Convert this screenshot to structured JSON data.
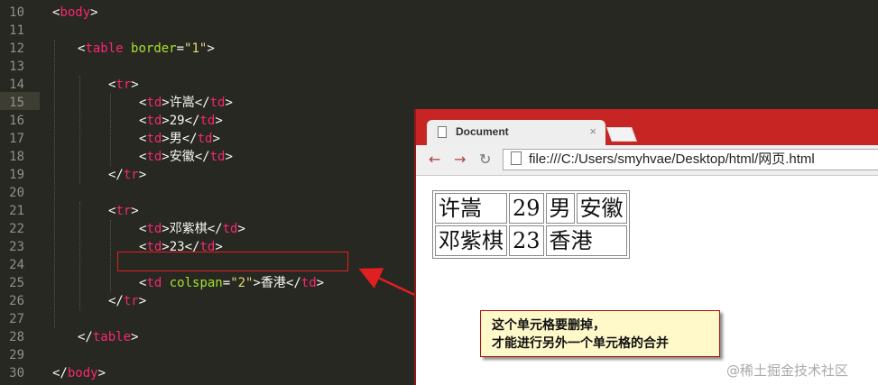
{
  "editor": {
    "lines": [
      {
        "n": "10",
        "tokens": [
          {
            "t": "<",
            "c": "plain"
          },
          {
            "t": "body",
            "c": "tag"
          },
          {
            "t": ">",
            "c": "plain"
          }
        ],
        "indent": 0
      },
      {
        "n": "11",
        "tokens": [],
        "indent": 0
      },
      {
        "n": "12",
        "tokens": [
          {
            "t": "<",
            "c": "plain"
          },
          {
            "t": "table",
            "c": "tag"
          },
          {
            "t": " ",
            "c": "plain"
          },
          {
            "t": "border",
            "c": "attr"
          },
          {
            "t": "=",
            "c": "plain"
          },
          {
            "t": "\"1\"",
            "c": "str"
          },
          {
            "t": ">",
            "c": "plain"
          }
        ],
        "indent": 1
      },
      {
        "n": "13",
        "tokens": [],
        "indent": 0
      },
      {
        "n": "14",
        "tokens": [
          {
            "t": "<",
            "c": "plain"
          },
          {
            "t": "tr",
            "c": "tag"
          },
          {
            "t": ">",
            "c": "plain"
          }
        ],
        "indent": 2
      },
      {
        "n": "15",
        "tokens": [
          {
            "t": "<",
            "c": "plain"
          },
          {
            "t": "td",
            "c": "tag"
          },
          {
            "t": ">许嵩</",
            "c": "plain"
          },
          {
            "t": "td",
            "c": "tag"
          },
          {
            "t": ">",
            "c": "plain"
          }
        ],
        "indent": 3
      },
      {
        "n": "16",
        "tokens": [
          {
            "t": "<",
            "c": "plain"
          },
          {
            "t": "td",
            "c": "tag"
          },
          {
            "t": ">29</",
            "c": "plain"
          },
          {
            "t": "td",
            "c": "tag"
          },
          {
            "t": ">",
            "c": "plain"
          }
        ],
        "indent": 3
      },
      {
        "n": "17",
        "tokens": [
          {
            "t": "<",
            "c": "plain"
          },
          {
            "t": "td",
            "c": "tag"
          },
          {
            "t": ">男</",
            "c": "plain"
          },
          {
            "t": "td",
            "c": "tag"
          },
          {
            "t": ">",
            "c": "plain"
          }
        ],
        "indent": 3
      },
      {
        "n": "18",
        "tokens": [
          {
            "t": "<",
            "c": "plain"
          },
          {
            "t": "td",
            "c": "tag"
          },
          {
            "t": ">安徽</",
            "c": "plain"
          },
          {
            "t": "td",
            "c": "tag"
          },
          {
            "t": ">",
            "c": "plain"
          }
        ],
        "indent": 3
      },
      {
        "n": "19",
        "tokens": [
          {
            "t": "</",
            "c": "plain"
          },
          {
            "t": "tr",
            "c": "tag"
          },
          {
            "t": ">",
            "c": "plain"
          }
        ],
        "indent": 2
      },
      {
        "n": "20",
        "tokens": [],
        "indent": 0
      },
      {
        "n": "21",
        "tokens": [
          {
            "t": "<",
            "c": "plain"
          },
          {
            "t": "tr",
            "c": "tag"
          },
          {
            "t": ">",
            "c": "plain"
          }
        ],
        "indent": 2
      },
      {
        "n": "22",
        "tokens": [
          {
            "t": "<",
            "c": "plain"
          },
          {
            "t": "td",
            "c": "tag"
          },
          {
            "t": ">邓紫棋</",
            "c": "plain"
          },
          {
            "t": "td",
            "c": "tag"
          },
          {
            "t": ">",
            "c": "plain"
          }
        ],
        "indent": 3
      },
      {
        "n": "23",
        "tokens": [
          {
            "t": "<",
            "c": "plain"
          },
          {
            "t": "td",
            "c": "tag"
          },
          {
            "t": ">23</",
            "c": "plain"
          },
          {
            "t": "td",
            "c": "tag"
          },
          {
            "t": ">",
            "c": "plain"
          }
        ],
        "indent": 3
      },
      {
        "n": "24",
        "tokens": [],
        "indent": 0
      },
      {
        "n": "25",
        "tokens": [
          {
            "t": "<",
            "c": "plain"
          },
          {
            "t": "td",
            "c": "tag"
          },
          {
            "t": " ",
            "c": "plain"
          },
          {
            "t": "colspan",
            "c": "attr"
          },
          {
            "t": "=",
            "c": "plain"
          },
          {
            "t": "\"2\"",
            "c": "str"
          },
          {
            "t": ">香港</",
            "c": "plain"
          },
          {
            "t": "td",
            "c": "tag"
          },
          {
            "t": ">",
            "c": "plain"
          }
        ],
        "indent": 3
      },
      {
        "n": "26",
        "tokens": [
          {
            "t": "</",
            "c": "plain"
          },
          {
            "t": "tr",
            "c": "tag"
          },
          {
            "t": ">",
            "c": "plain"
          }
        ],
        "indent": 2
      },
      {
        "n": "27",
        "tokens": [],
        "indent": 0
      },
      {
        "n": "28",
        "tokens": [
          {
            "t": "</",
            "c": "plain"
          },
          {
            "t": "table",
            "c": "tag"
          },
          {
            "t": ">",
            "c": "plain"
          }
        ],
        "indent": 1
      },
      {
        "n": "29",
        "tokens": [],
        "indent": 0
      },
      {
        "n": "30",
        "tokens": [
          {
            "t": "</",
            "c": "plain"
          },
          {
            "t": "body",
            "c": "tag"
          },
          {
            "t": ">",
            "c": "plain"
          }
        ],
        "indent": 0
      }
    ]
  },
  "browser": {
    "tab_title": "Document",
    "tab_close": "×",
    "back": "←",
    "forward": "→",
    "reload": "↻",
    "url": "file:///C:/Users/smyhvae/Desktop/html/网页.html",
    "table": {
      "rows": [
        [
          "许嵩",
          "29",
          "男",
          "安徽"
        ],
        [
          "邓紫棋",
          "23",
          "香港"
        ]
      ]
    }
  },
  "callout": {
    "line1": "这个单元格要删掉，",
    "line2": "才能进行另外一个单元格的合并"
  },
  "watermark": "@稀土掘金技术社区",
  "colors": {
    "editor_bg": "#272822",
    "tag": "#f92672",
    "attr": "#a6e22e",
    "string": "#e6db74",
    "highlight_red": "#e02020",
    "browser_frame": "#c72524",
    "callout_bg": "#fff8c8"
  }
}
